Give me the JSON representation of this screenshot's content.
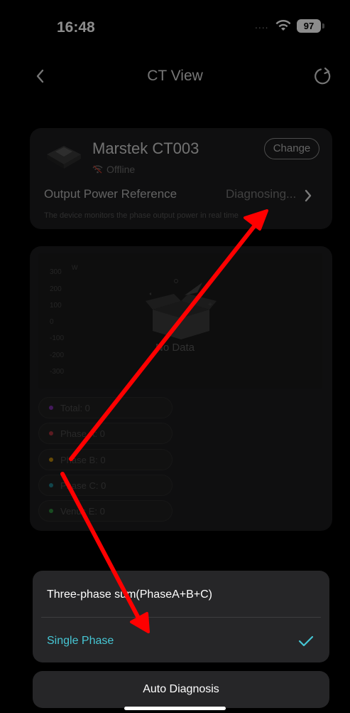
{
  "status_bar": {
    "time": "16:48",
    "signal": "....",
    "battery": "97"
  },
  "nav": {
    "title": "CT View"
  },
  "device": {
    "name": "Marstek CT003",
    "status": "Offline",
    "change_label": "Change",
    "output_label": "Output Power Reference",
    "output_value": "Diagnosing...",
    "description": "The device monitors the phase output power in real time"
  },
  "chart_data": {
    "type": "line",
    "ylabel": "W",
    "y_ticks": [
      "300",
      "200",
      "100",
      "0",
      "-100",
      "-200",
      "-300"
    ],
    "ylim": [
      -300,
      300
    ],
    "series": [],
    "empty_text": "No Data"
  },
  "legend": [
    {
      "label": "Total: 0",
      "color": "#7b2fa8"
    },
    {
      "label": "Phase A: 0",
      "color": "#a8323c"
    },
    {
      "label": "Phase B: 0",
      "color": "#b8860b"
    },
    {
      "label": "Phase C: 0",
      "color": "#1f7f8a"
    },
    {
      "label": "Venus E: 0",
      "color": "#2e8b3c"
    }
  ],
  "options": {
    "three_phase": "Three-phase sum(PhaseA+B+C)",
    "single_phase": "Single Phase",
    "selected": "single_phase",
    "accent": "#46c6d4"
  },
  "auto_diagnosis_label": "Auto Diagnosis",
  "annotation_color": "#ff0000"
}
